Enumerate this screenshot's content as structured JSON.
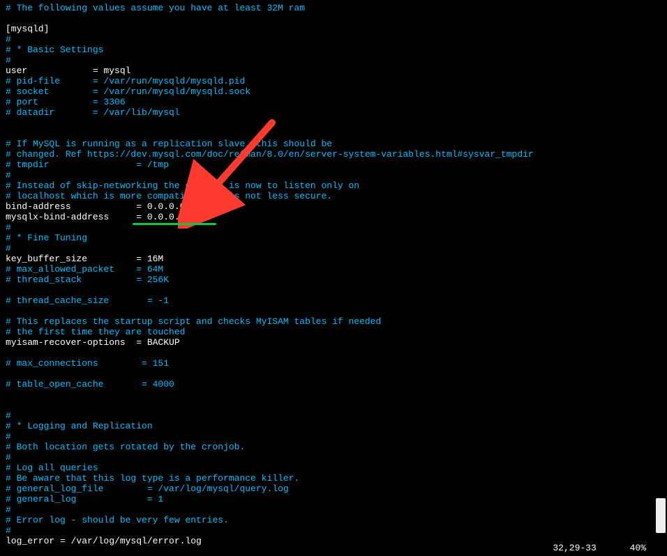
{
  "lines": [
    {
      "cls": "comment",
      "text": "# The following values assume you have at least 32M ram"
    },
    {
      "cls": "plain",
      "text": ""
    },
    {
      "cls": "plain",
      "text": "[mysqld]"
    },
    {
      "cls": "comment",
      "text": "#"
    },
    {
      "cls": "comment",
      "text": "# * Basic Settings"
    },
    {
      "cls": "comment",
      "text": "#"
    },
    {
      "cls": "plain",
      "text": "user            = mysql"
    },
    {
      "cls": "comment",
      "text": "# pid-file      = /var/run/mysqld/mysqld.pid"
    },
    {
      "cls": "comment",
      "text": "# socket        = /var/run/mysqld/mysqld.sock"
    },
    {
      "cls": "comment",
      "text": "# port          = 3306"
    },
    {
      "cls": "comment",
      "text": "# datadir       = /var/lib/mysql"
    },
    {
      "cls": "plain",
      "text": ""
    },
    {
      "cls": "plain",
      "text": ""
    },
    {
      "cls": "comment",
      "text": "# If MySQL is running as a replication slave, this should be"
    },
    {
      "cls": "comment",
      "text": "# changed. Ref https://dev.mysql.com/doc/refman/8.0/en/server-system-variables.html#sysvar_tmpdir"
    },
    {
      "cls": "comment",
      "text": "# tmpdir                = /tmp"
    },
    {
      "cls": "comment",
      "text": "#"
    },
    {
      "cls": "comment",
      "text": "# Instead of skip-networking the default is now to listen only on"
    },
    {
      "cls": "comment",
      "text": "# localhost which is more compatible and is not less secure."
    },
    {
      "cls": "plain",
      "text": "bind-address            = 0.0.0.0"
    },
    {
      "cls": "plain",
      "text": "mysqlx-bind-address     = 0.0.0.",
      "cursor": "0"
    },
    {
      "cls": "comment",
      "text": "#"
    },
    {
      "cls": "comment",
      "text": "# * Fine Tuning"
    },
    {
      "cls": "comment",
      "text": "#"
    },
    {
      "cls": "plain",
      "text": "key_buffer_size         = 16M"
    },
    {
      "cls": "comment",
      "text": "# max_allowed_packet    = 64M"
    },
    {
      "cls": "comment",
      "text": "# thread_stack          = 256K"
    },
    {
      "cls": "plain",
      "text": ""
    },
    {
      "cls": "comment",
      "text": "# thread_cache_size       = -1"
    },
    {
      "cls": "plain",
      "text": ""
    },
    {
      "cls": "comment",
      "text": "# This replaces the startup script and checks MyISAM tables if needed"
    },
    {
      "cls": "comment",
      "text": "# the first time they are touched"
    },
    {
      "cls": "plain",
      "text": "myisam-recover-options  = BACKUP"
    },
    {
      "cls": "plain",
      "text": ""
    },
    {
      "cls": "comment",
      "text": "# max_connections        = 151"
    },
    {
      "cls": "plain",
      "text": ""
    },
    {
      "cls": "comment",
      "text": "# table_open_cache       = 4000"
    },
    {
      "cls": "plain",
      "text": ""
    },
    {
      "cls": "plain",
      "text": ""
    },
    {
      "cls": "comment",
      "text": "#"
    },
    {
      "cls": "comment",
      "text": "# * Logging and Replication"
    },
    {
      "cls": "comment",
      "text": "#"
    },
    {
      "cls": "comment",
      "text": "# Both location gets rotated by the cronjob."
    },
    {
      "cls": "comment",
      "text": "#"
    },
    {
      "cls": "comment",
      "text": "# Log all queries"
    },
    {
      "cls": "comment",
      "text": "# Be aware that this log type is a performance killer."
    },
    {
      "cls": "comment",
      "text": "# general_log_file        = /var/log/mysql/query.log"
    },
    {
      "cls": "comment",
      "text": "# general_log             = 1"
    },
    {
      "cls": "comment",
      "text": "#"
    },
    {
      "cls": "comment",
      "text": "# Error log - should be very few entries."
    },
    {
      "cls": "comment",
      "text": "#"
    },
    {
      "cls": "plain",
      "text": "log_error = /var/log/mysql/error.log"
    }
  ],
  "status": {
    "position": "32,29-33",
    "percent": "40%"
  }
}
